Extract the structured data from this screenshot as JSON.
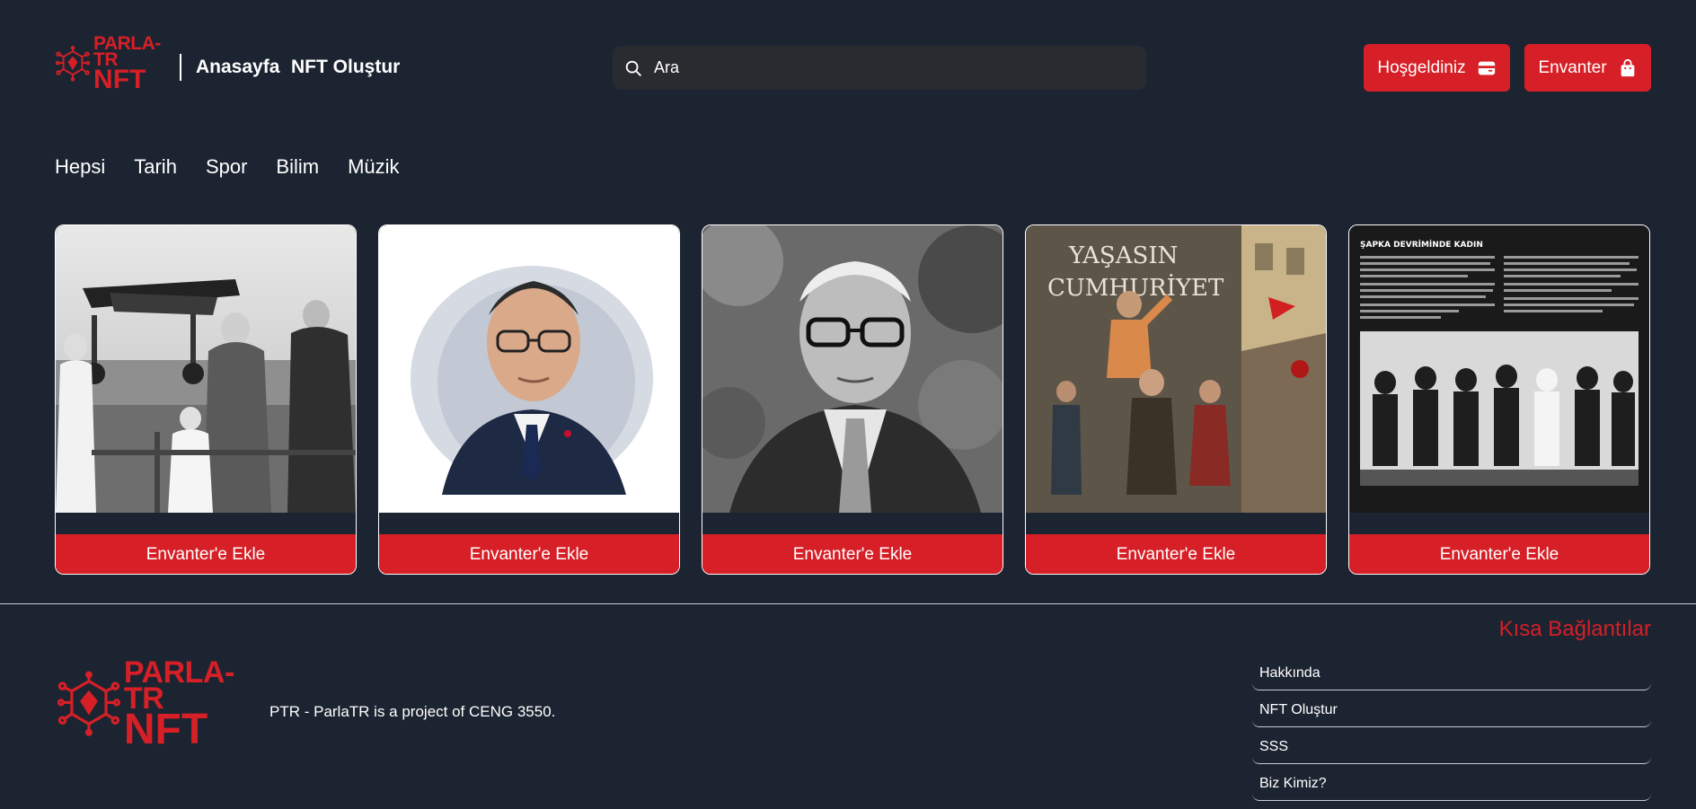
{
  "brand": {
    "logo_line1": "PARLA-TR",
    "logo_line2": "NFT"
  },
  "nav": {
    "home": "Anasayfa",
    "create": "NFT Oluştur"
  },
  "search": {
    "placeholder": "Ara"
  },
  "header_buttons": {
    "welcome": "Hoşgeldiniz",
    "inventory": "Envanter"
  },
  "categories": [
    "Hepsi",
    "Tarih",
    "Spor",
    "Bilim",
    "Müzik"
  ],
  "cards": [
    {
      "button": "Envanter'e Ekle"
    },
    {
      "button": "Envanter'e Ekle"
    },
    {
      "button": "Envanter'e Ekle"
    },
    {
      "button": "Envanter'e Ekle"
    },
    {
      "button": "Envanter'e Ekle"
    }
  ],
  "card_texts": {
    "card4_slogan_1": "YAŞASIN",
    "card4_slogan_2": "CUMHURİYET",
    "card5_heading": "ŞAPKA DEVRİMİNDE KADIN"
  },
  "footer": {
    "tagline": "PTR - ParlaTR is a project of CENG 3550.",
    "quick_links_title": "Kısa Bağlantılar",
    "links": [
      "Hakkında",
      "NFT Oluştur",
      "SSS",
      "Biz Kimiz?"
    ]
  },
  "colors": {
    "background": "#1c2431",
    "accent": "#d61f26",
    "search_bg": "#2a2b30"
  }
}
